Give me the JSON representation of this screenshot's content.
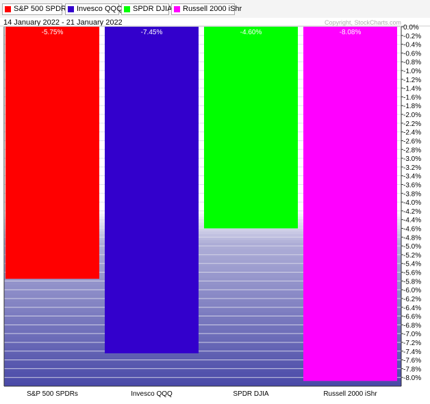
{
  "legend": [
    {
      "label": "S&P 500 SPDRs",
      "color": "#ff0000"
    },
    {
      "label": "Invesco QQQ",
      "color": "#3300cc"
    },
    {
      "label": "SPDR DJIA",
      "color": "#00ff00"
    },
    {
      "label": "Russell 2000 iShr",
      "color": "#ff00ff"
    }
  ],
  "header": {
    "date_range": "14 January 2022 - 21 January 2022",
    "copyright": "Copyright, StockCharts.com"
  },
  "chart_data": {
    "type": "bar",
    "categories": [
      "S&P 500 SPDRs",
      "Invesco QQQ",
      "SPDR DJIA",
      "Russell 2000 iShr"
    ],
    "values": [
      -5.75,
      -7.45,
      -4.6,
      -8.08
    ],
    "data_labels": [
      "-5.75%",
      "-7.45%",
      "-4.60%",
      "-8.08%"
    ],
    "colors": [
      "#ff0000",
      "#3300cc",
      "#00ff00",
      "#ff00ff"
    ],
    "ylim": [
      -8.2,
      0
    ],
    "y_ticks": [
      0,
      -0.2,
      -0.4,
      -0.6,
      -0.8,
      -1.0,
      -1.2,
      -1.4,
      -1.6,
      -1.8,
      -2.0,
      -2.2,
      -2.4,
      -2.6,
      -2.8,
      -3.0,
      -3.2,
      -3.4,
      -3.6,
      -3.8,
      -4.0,
      -4.2,
      -4.4,
      -4.6,
      -4.8,
      -5.0,
      -5.2,
      -5.4,
      -5.6,
      -5.8,
      -6.0,
      -6.2,
      -6.4,
      -6.6,
      -6.8,
      -7.0,
      -7.2,
      -7.4,
      -7.6,
      -7.8,
      -8.0
    ],
    "y_tick_labels": [
      "0.0%",
      "-0.2%",
      "-0.4%",
      "-0.6%",
      "-0.8%",
      "-1.0%",
      "-1.2%",
      "-1.4%",
      "-1.6%",
      "-1.8%",
      "-2.0%",
      "-2.2%",
      "-2.4%",
      "-2.6%",
      "-2.8%",
      "-3.0%",
      "-3.2%",
      "-3.4%",
      "-3.6%",
      "-3.8%",
      "-4.0%",
      "-4.2%",
      "-4.4%",
      "-4.6%",
      "-4.8%",
      "-5.0%",
      "-5.2%",
      "-5.4%",
      "-5.6%",
      "-5.8%",
      "-6.0%",
      "-6.2%",
      "-6.4%",
      "-6.6%",
      "-6.8%",
      "-7.0%",
      "-7.2%",
      "-7.4%",
      "-7.6%",
      "-7.8%",
      "-8.0%"
    ],
    "axis_side": "right",
    "grid": true,
    "legend_position": "top"
  }
}
